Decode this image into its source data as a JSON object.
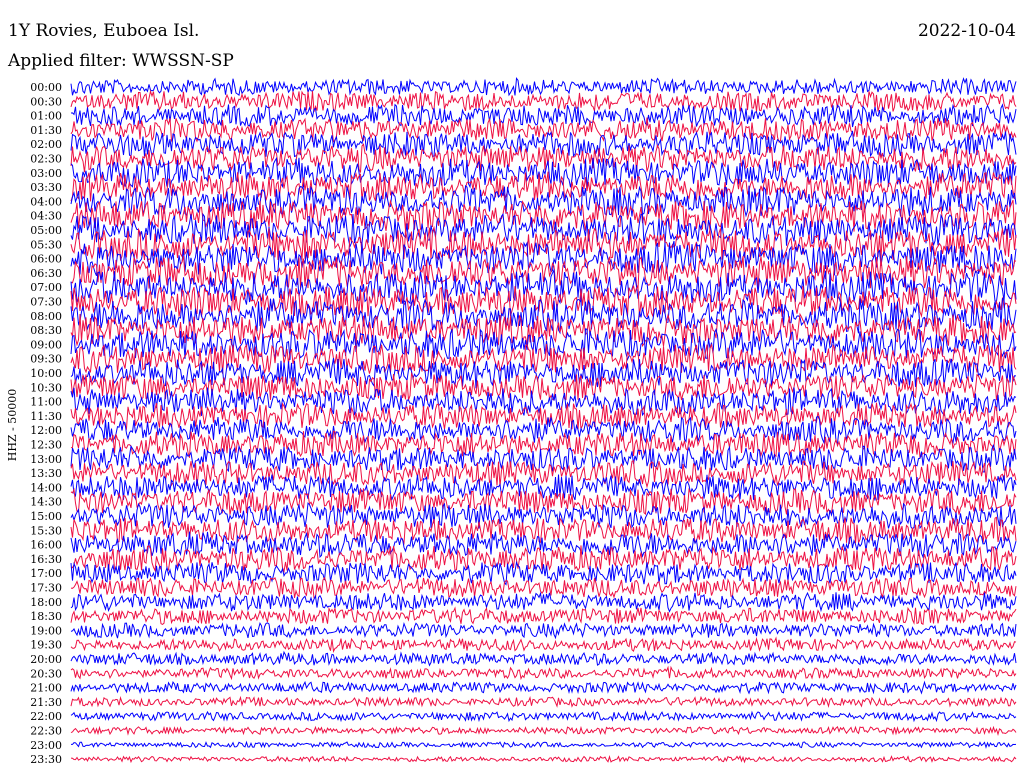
{
  "header": {
    "station": "1Y Rovies, Euboea Isl.",
    "date": "2022-10-04",
    "filter": "Applied filter: WWSSN-SP"
  },
  "chart_data": {
    "type": "line",
    "title": "1Y Rovies, Euboea Isl.",
    "subtitle": "Applied filter: WWSSN-SP",
    "date": "2022-10-04",
    "ylabel": "HHZ - 50000",
    "row_labels": [
      "00:00",
      "00:30",
      "01:00",
      "01:30",
      "02:00",
      "02:30",
      "03:00",
      "03:30",
      "04:00",
      "04:30",
      "05:00",
      "05:30",
      "06:00",
      "06:30",
      "07:00",
      "07:30",
      "08:00",
      "08:30",
      "09:00",
      "09:30",
      "10:00",
      "10:30",
      "11:00",
      "11:30",
      "12:00",
      "12:30",
      "13:00",
      "13:30",
      "14:00",
      "14:30",
      "15:00",
      "15:30",
      "16:00",
      "16:30",
      "17:00",
      "17:30",
      "18:00",
      "18:30",
      "19:00",
      "19:30",
      "20:00",
      "20:30",
      "21:00",
      "21:30",
      "22:00",
      "22:30",
      "23:00",
      "23:30"
    ],
    "trace_colors": [
      "#ee1144",
      "#0000ff"
    ],
    "row_amplitude": [
      9,
      11,
      12,
      13,
      14,
      15,
      16,
      16,
      17,
      17,
      17,
      18,
      18,
      18,
      18,
      18,
      18,
      17,
      17,
      16,
      16,
      15,
      15,
      14,
      14,
      14,
      14,
      14,
      14,
      14,
      14,
      14,
      14,
      14,
      12,
      11,
      10,
      9,
      8,
      7,
      7,
      6,
      6,
      5,
      5,
      4,
      3,
      3
    ],
    "grid": false,
    "legend": "none"
  }
}
